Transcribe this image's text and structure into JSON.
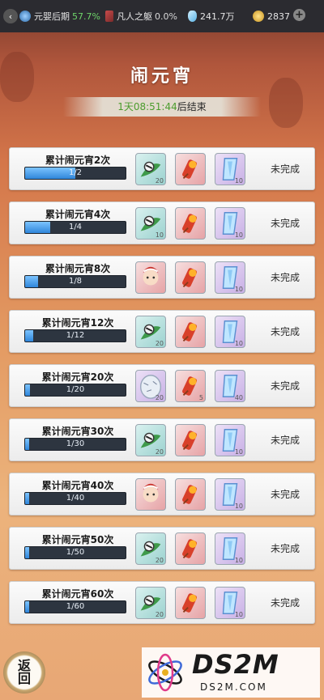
{
  "statusbar": {
    "realm_label": "元婴后期",
    "realm_pct": "57.7%",
    "body_label": "凡人之躯",
    "body_pct": "0.0%",
    "spirit_stones": "241.7万",
    "gold": "2837",
    "plus": "+"
  },
  "page": {
    "title": "闹元宵",
    "timer_time": "1天08:51:44",
    "timer_suffix": "后结束"
  },
  "tasks": [
    {
      "title": "累计闹元宵2次",
      "progress": "1/2",
      "progress_fraction": 0.5,
      "rewards": [
        {
          "icon": "ink-stone-icon",
          "qty": "20"
        },
        {
          "icon": "firecracker-icon",
          "qty": ""
        },
        {
          "icon": "crystal-talisman-icon",
          "qty": "10"
        }
      ],
      "status": "未完成"
    },
    {
      "title": "累计闹元宵4次",
      "progress": "1/4",
      "progress_fraction": 0.25,
      "rewards": [
        {
          "icon": "ink-stone-icon",
          "qty": "10"
        },
        {
          "icon": "firecracker-icon",
          "qty": ""
        },
        {
          "icon": "crystal-talisman-icon",
          "qty": "10"
        }
      ],
      "status": "未完成"
    },
    {
      "title": "累计闹元宵8次",
      "progress": "1/8",
      "progress_fraction": 0.125,
      "rewards": [
        {
          "icon": "character-avatar-icon",
          "qty": ""
        },
        {
          "icon": "firecracker-icon",
          "qty": ""
        },
        {
          "icon": "crystal-talisman-icon",
          "qty": "10"
        }
      ],
      "status": "未完成"
    },
    {
      "title": "累计闹元宵12次",
      "progress": "1/12",
      "progress_fraction": 0.083,
      "rewards": [
        {
          "icon": "ink-stone-icon",
          "qty": "20"
        },
        {
          "icon": "firecracker-icon",
          "qty": ""
        },
        {
          "icon": "crystal-talisman-icon",
          "qty": "10"
        }
      ],
      "status": "未完成"
    },
    {
      "title": "累计闹元宵20次",
      "progress": "1/20",
      "progress_fraction": 0.05,
      "rewards": [
        {
          "icon": "spirit-egg-icon",
          "qty": "20"
        },
        {
          "icon": "firecracker-icon",
          "qty": "5"
        },
        {
          "icon": "crystal-talisman-icon",
          "qty": "40"
        }
      ],
      "status": "未完成"
    },
    {
      "title": "累计闹元宵30次",
      "progress": "1/30",
      "progress_fraction": 0.033,
      "rewards": [
        {
          "icon": "ink-stone-icon",
          "qty": "20"
        },
        {
          "icon": "firecracker-icon",
          "qty": ""
        },
        {
          "icon": "crystal-talisman-icon",
          "qty": "10"
        }
      ],
      "status": "未完成"
    },
    {
      "title": "累计闹元宵40次",
      "progress": "1/40",
      "progress_fraction": 0.025,
      "rewards": [
        {
          "icon": "character-avatar-icon",
          "qty": ""
        },
        {
          "icon": "firecracker-icon",
          "qty": ""
        },
        {
          "icon": "crystal-talisman-icon",
          "qty": "10"
        }
      ],
      "status": "未完成"
    },
    {
      "title": "累计闹元宵50次",
      "progress": "1/50",
      "progress_fraction": 0.02,
      "rewards": [
        {
          "icon": "ink-stone-icon",
          "qty": "20"
        },
        {
          "icon": "firecracker-icon",
          "qty": ""
        },
        {
          "icon": "crystal-talisman-icon",
          "qty": "10"
        }
      ],
      "status": "未完成"
    },
    {
      "title": "累计闹元宵60次",
      "progress": "1/60",
      "progress_fraction": 0.017,
      "rewards": [
        {
          "icon": "ink-stone-icon",
          "qty": "20"
        },
        {
          "icon": "firecracker-icon",
          "qty": ""
        },
        {
          "icon": "crystal-talisman-icon",
          "qty": "10"
        }
      ],
      "status": "未完成"
    }
  ],
  "bottom": {
    "return_label": "返回",
    "watermark_big": "DS2M",
    "watermark_small": "DS2M.COM"
  },
  "colors": {
    "progress_fill": "#2f86da",
    "timer_green": "#4c9c2e",
    "realm_green": "#6fd46a"
  }
}
